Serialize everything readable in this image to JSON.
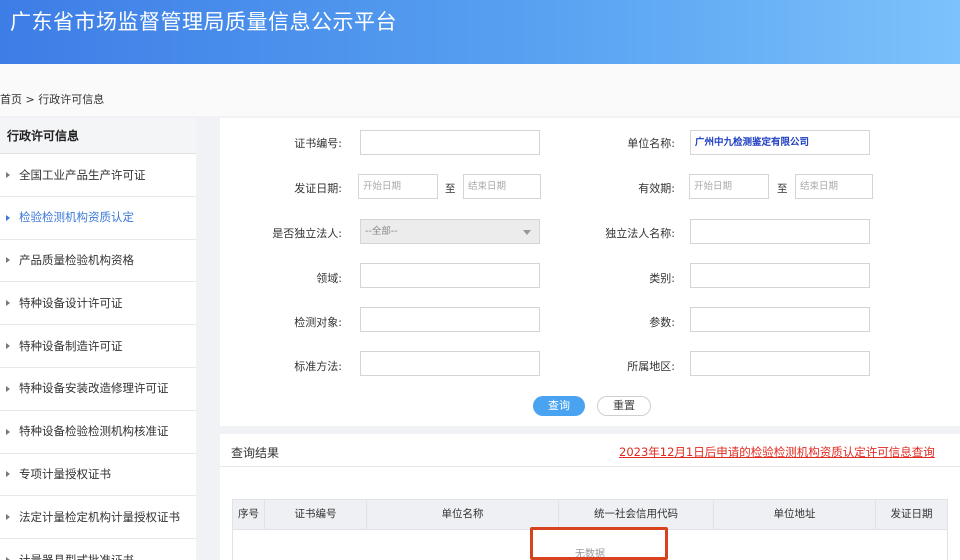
{
  "header": {
    "title": "广东省市场监督管理局质量信息公示平台"
  },
  "breadcrumb": {
    "home": "首页",
    "separator": ">",
    "current": "行政许可信息"
  },
  "sidebar": {
    "title": "行政许可信息",
    "items": [
      {
        "label": "全国工业产品生产许可证",
        "active": false
      },
      {
        "label": "检验检测机构资质认定",
        "active": true
      },
      {
        "label": "产品质量检验机构资格",
        "active": false
      },
      {
        "label": "特种设备设计许可证",
        "active": false
      },
      {
        "label": "特种设备制造许可证",
        "active": false
      },
      {
        "label": "特种设备安装改造修理许可证",
        "active": false
      },
      {
        "label": "特种设备检验检测机构核准证",
        "active": false
      },
      {
        "label": "专项计量授权证书",
        "active": false
      },
      {
        "label": "法定计量检定机构计量授权证书",
        "active": false
      },
      {
        "label": "计量器具型式批准证书",
        "active": false
      }
    ]
  },
  "form": {
    "cert_no": {
      "label": "证书编号:",
      "value": ""
    },
    "unit_name": {
      "label": "单位名称:",
      "value": "广州中九检测鉴定有限公司"
    },
    "issue_date": {
      "label": "发证日期:",
      "start_placeholder": "开始日期",
      "to": "至",
      "end_placeholder": "结束日期"
    },
    "valid_period": {
      "label": "有效期:",
      "start_placeholder": "开始日期",
      "to": "至",
      "end_placeholder": "结束日期"
    },
    "independent_legal": {
      "label": "是否独立法人:",
      "value": "--全部--"
    },
    "independent_legal_name": {
      "label": "独立法人名称:",
      "value": ""
    },
    "field": {
      "label": "领域:",
      "value": ""
    },
    "category": {
      "label": "类别:",
      "value": ""
    },
    "test_object": {
      "label": "检测对象:",
      "value": ""
    },
    "parameter": {
      "label": "参数:",
      "value": ""
    },
    "standard_method": {
      "label": "标准方法:",
      "value": ""
    },
    "region": {
      "label": "所属地区:",
      "value": ""
    },
    "query_button": "查询",
    "reset_button": "重置"
  },
  "results": {
    "title": "查询结果",
    "link": "2023年12月1日后申请的检验检测机构资质认定许可信息查询",
    "columns": [
      "序号",
      "证书编号",
      "单位名称",
      "统一社会信用代码",
      "单位地址",
      "发证日期"
    ],
    "empty_text": "无数据"
  },
  "colors": {
    "header_start": "#3d7de6",
    "header_end": "#7cc2fb",
    "active_link": "#3a78d8",
    "query_button": "#4aa3f0",
    "results_link": "#e0291f",
    "highlight_box": "#d8431f"
  }
}
